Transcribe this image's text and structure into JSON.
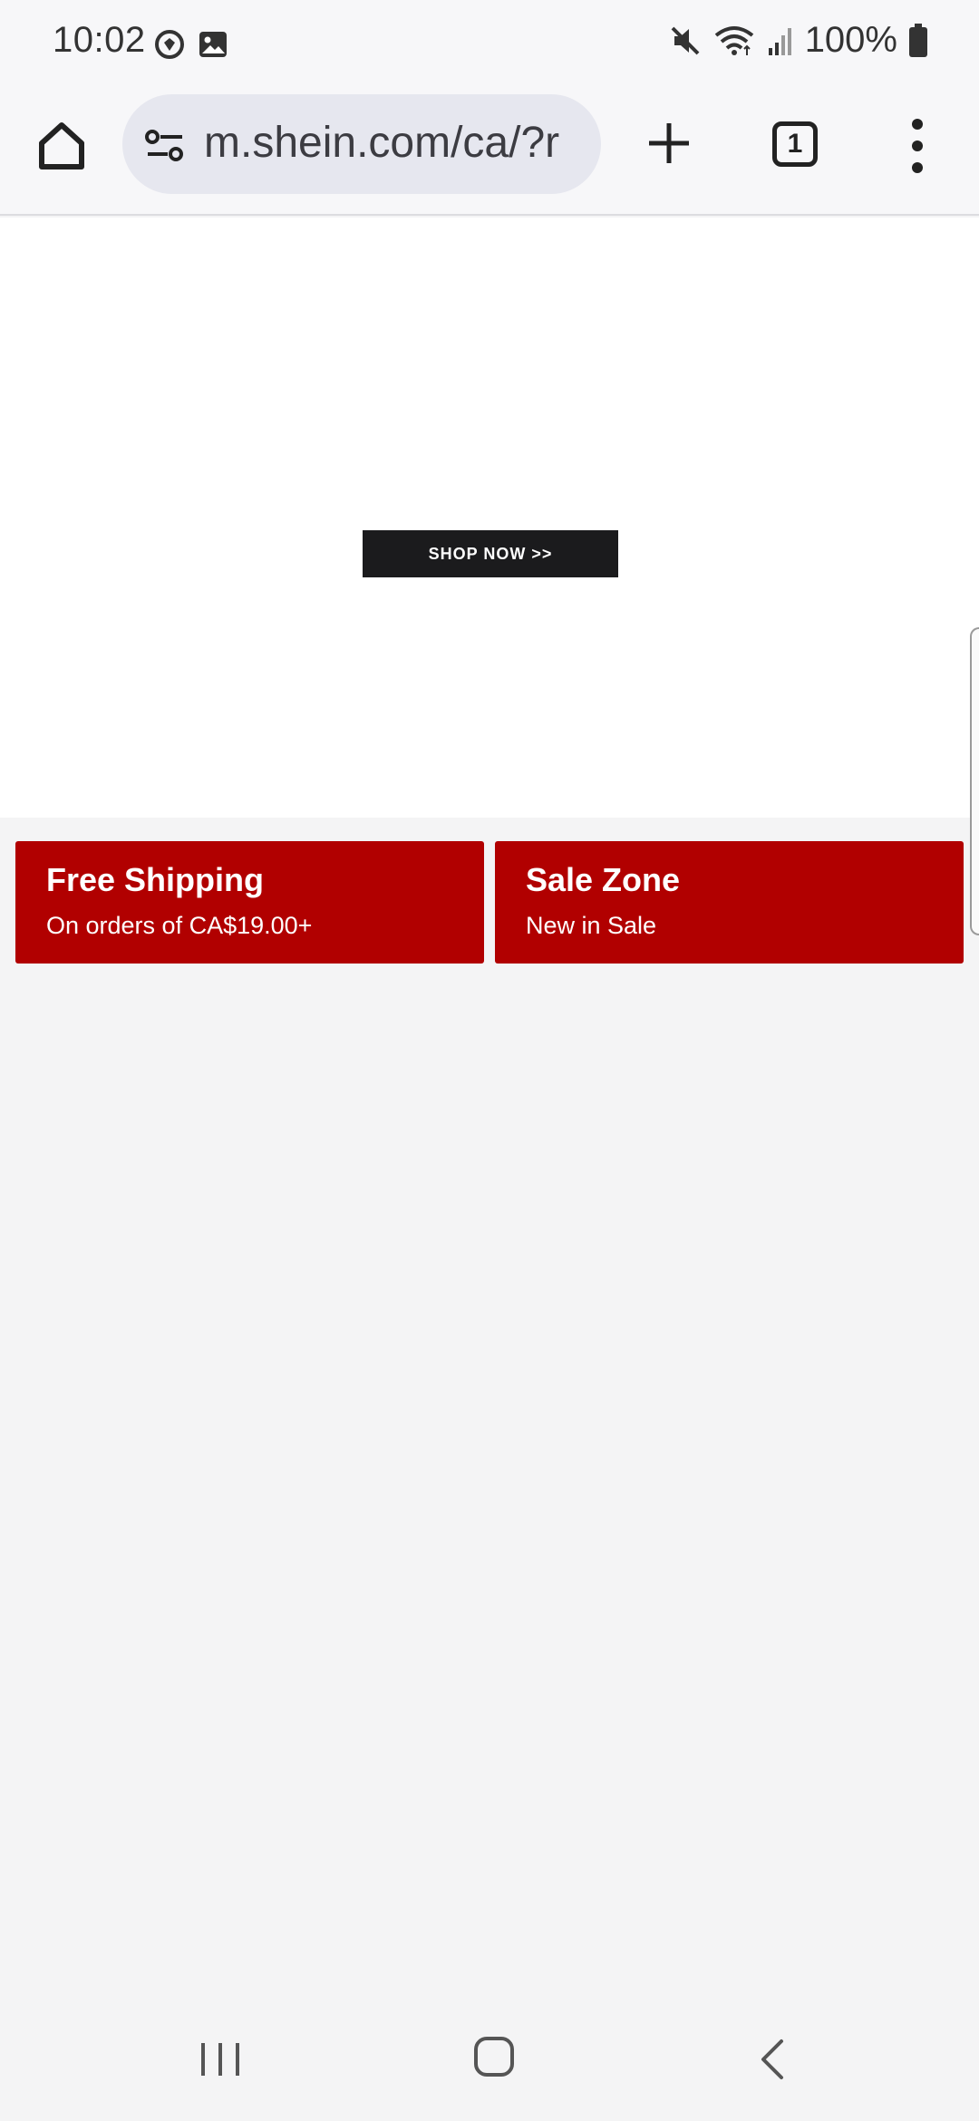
{
  "status_bar": {
    "time": "10:02",
    "battery": "100%",
    "icons": [
      "sync-icon",
      "gallery-icon",
      "mute-icon",
      "wifi-icon",
      "signal-icon",
      "battery-icon"
    ]
  },
  "browser": {
    "url": "m.shein.com/ca/?r",
    "tab_count": "1",
    "icons": [
      "home-icon",
      "site-settings-icon",
      "plus-icon",
      "tabs-icon",
      "more-vert-icon"
    ]
  },
  "hero": {
    "cta_label": "SHOP NOW >>"
  },
  "promos": [
    {
      "title": "Free Shipping",
      "subtitle": "On orders of CA$19.00+"
    },
    {
      "title": "Sale Zone",
      "subtitle": "New in Sale"
    }
  ],
  "colors": {
    "promo_red": "#b10000",
    "cta_black": "#1b1b1d",
    "page_bg": "#f4f4f5",
    "url_pill": "#e6e7ef"
  },
  "nav": {
    "icons": [
      "recent-apps-icon",
      "home-nav-icon",
      "back-icon"
    ]
  }
}
